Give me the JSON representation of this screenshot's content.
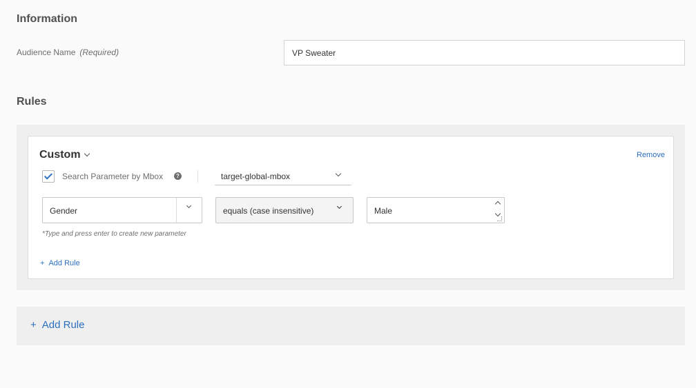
{
  "information": {
    "title": "Information",
    "audience_name_label": "Audience Name",
    "audience_name_required": "(Required)",
    "audience_name_value": "VP Sweater"
  },
  "rules": {
    "title": "Rules",
    "card": {
      "type_label": "Custom",
      "remove_label": "Remove",
      "search_by_mbox_checked": true,
      "search_by_mbox_label": "Search Parameter by Mbox",
      "help_glyph": "?",
      "mbox_value": "target-global-mbox",
      "parameter_value": "Gender",
      "operator_value": "equals (case insensitive)",
      "match_value": "Male",
      "hint": "*Type and press enter to create new parameter",
      "add_rule_plus": "+",
      "add_rule_label": "Add Rule"
    },
    "add_rule_plus": "+",
    "add_rule_label": "Add Rule"
  },
  "colors": {
    "link": "#2c6ebf",
    "panel": "#efefef",
    "text": "#323232"
  }
}
